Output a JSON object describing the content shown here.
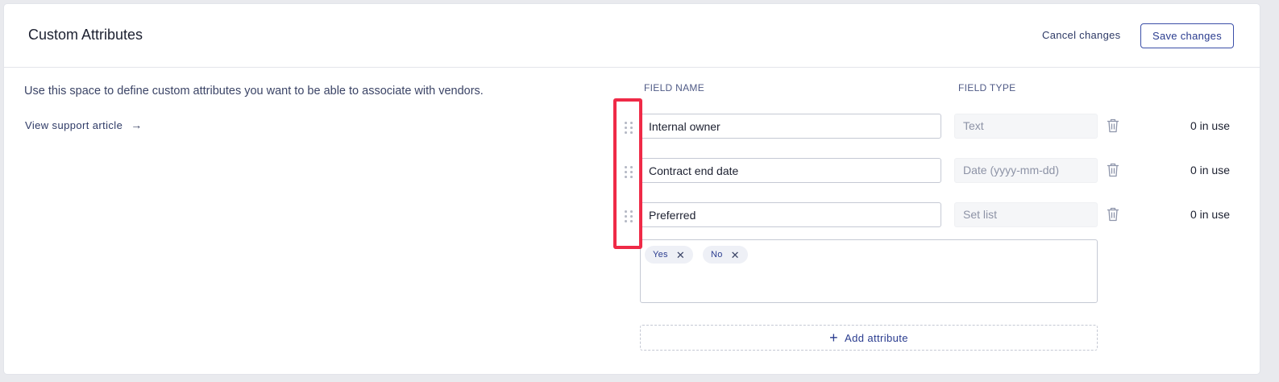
{
  "header": {
    "title": "Custom Attributes",
    "cancel_label": "Cancel changes",
    "save_label": "Save changes"
  },
  "intro": {
    "description": "Use this space to define custom attributes you want to be able to associate with vendors.",
    "support_link": "View support article"
  },
  "columns": {
    "field_name": "FIELD NAME",
    "field_type": "FIELD TYPE"
  },
  "attributes": [
    {
      "name": "Internal owner",
      "type": "Text",
      "usage": "0 in use"
    },
    {
      "name": "Contract end date",
      "type": "Date (yyyy-mm-dd)",
      "usage": "0 in use"
    },
    {
      "name": "Preferred",
      "type": "Set list",
      "usage": "0 in use"
    }
  ],
  "set_list_options": [
    "Yes",
    "No"
  ],
  "add_attribute_label": "Add attribute",
  "colors": {
    "accent": "#2a3c8f",
    "highlight": "#ef2a47"
  }
}
